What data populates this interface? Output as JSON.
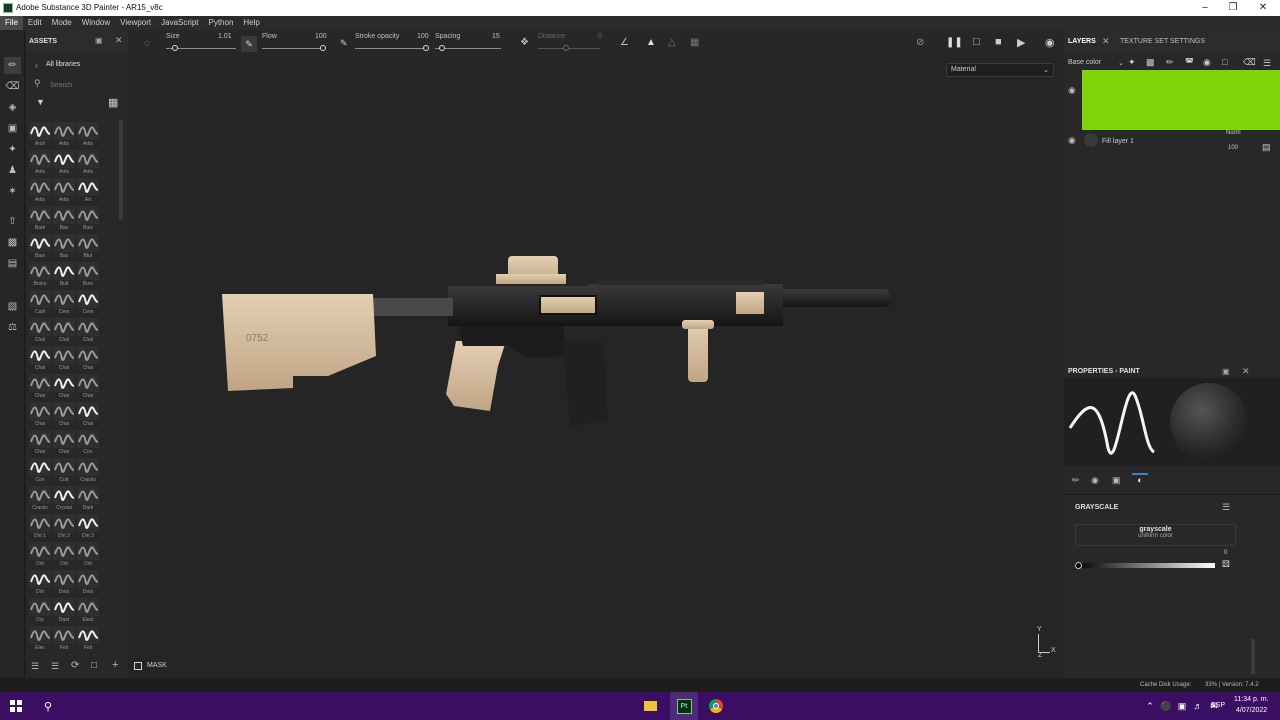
{
  "window": {
    "title": "Adobe Substance 3D Painter - AR15_v8c",
    "app_icon": "substance-painter-icon",
    "controls": [
      "minimize-icon",
      "maximize-icon",
      "close-icon"
    ]
  },
  "menu": [
    "File",
    "Edit",
    "Mode",
    "Window",
    "Viewport",
    "JavaScript",
    "Python",
    "Help"
  ],
  "assets": {
    "title": "ASSETS",
    "library": "All libraries",
    "search_placeholder": "Search",
    "tiles": [
      [
        "Arch",
        "Artis",
        "Artis"
      ],
      [
        "Artis",
        "Artis",
        "Artis"
      ],
      [
        "Artis",
        "Artis",
        "Art"
      ],
      [
        "Bark",
        "Bas",
        "Basi"
      ],
      [
        "Basi",
        "Bas",
        "Blur"
      ],
      [
        "Broke",
        "Bull",
        "Burn"
      ],
      [
        "Calli",
        "Cem",
        "Cem"
      ],
      [
        "Chal",
        "Chal",
        "Chal"
      ],
      [
        "Chal",
        "Chal",
        "Char"
      ],
      [
        "Char",
        "Char",
        "Char"
      ],
      [
        "Char",
        "Char",
        "Char"
      ],
      [
        "Char",
        "Char",
        "Con"
      ],
      [
        "Con",
        "Cott",
        "Cracks"
      ],
      [
        "Cracks",
        "Crystal",
        "Dark"
      ],
      [
        "Dirt 1",
        "Dirt 2",
        "Dirt 3"
      ],
      [
        "Dirt",
        "Dirt",
        "Dirt"
      ],
      [
        "Dirt",
        "Dots",
        "Dots"
      ],
      [
        "Dry",
        "Dust",
        "Elect"
      ],
      [
        "Elec",
        "Felt",
        "Felt"
      ]
    ]
  },
  "toolbar": {
    "size_label": "Size",
    "size_value": "1.01",
    "flow_label": "Flow",
    "flow_value": "100",
    "stroke_label": "Stroke opacity",
    "stroke_value": "100",
    "spacing_label": "Spacing",
    "spacing_value": "15",
    "distance_label": "Distance",
    "distance_value": "0"
  },
  "viewport": {
    "material_dropdown": "Material",
    "mask_label": "MASK",
    "gizmo_y": "Y",
    "gizmo_x": "X",
    "gizmo_z": "Z"
  },
  "layers_panel": {
    "tab_layers": "LAYERS",
    "tab_texture": "TEXTURE SET SETTINGS",
    "channel": "Base color",
    "fill_color": "#7ed60a",
    "layer_name": "Fill layer 1",
    "blend_mode": "Norm",
    "opacity": "100"
  },
  "properties": {
    "title": "PROPERTIES - PAINT",
    "section": "GRAYSCALE",
    "gray_title": "grayscale",
    "gray_sub": "uniform color",
    "gray_value": "0"
  },
  "status": {
    "cache_label": "Cache Disk Usage:",
    "cache_value": "33%",
    "version": "| Version: 7.4.2"
  },
  "taskbar": {
    "lang": "ESP",
    "time": "11:34 p. m.",
    "date": "4/07/2022"
  }
}
